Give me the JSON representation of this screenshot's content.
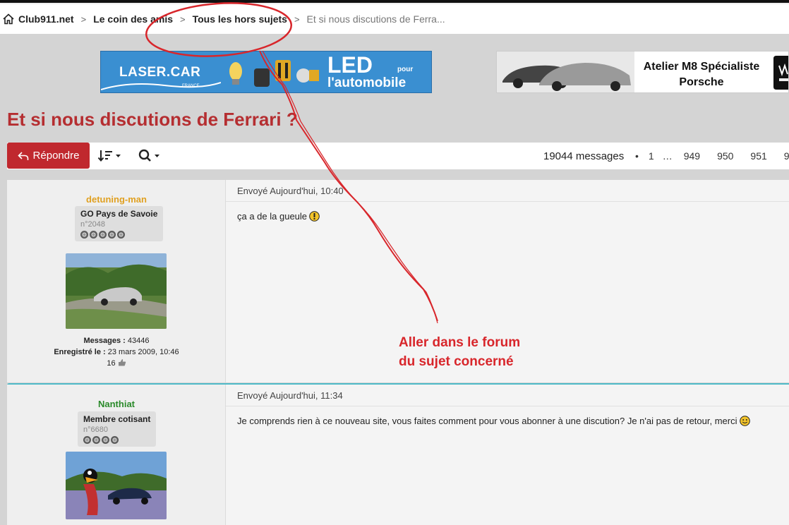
{
  "breadcrumb": {
    "home": "Club911.net",
    "items": [
      "Le coin des amis",
      "Tous les hors sujets"
    ],
    "current": "Et si nous discutions de Ferra...",
    "separator": ">"
  },
  "ads": {
    "laser": {
      "brand": "LASER.CAR",
      "brand_sub": "FRANCE",
      "led": "LED",
      "pour": "pour",
      "automobile": "l'automobile"
    },
    "m8": {
      "line1": "Atelier M8 Spécialiste",
      "line2": "Porsche"
    }
  },
  "thread": {
    "title": "Et si nous discutions de Ferrari ?"
  },
  "toolbar": {
    "reply_label": "Répondre",
    "message_count": "19044 messages",
    "bullet": "•",
    "pages": [
      "1",
      "…",
      "949",
      "950",
      "951",
      "9"
    ]
  },
  "posts": [
    {
      "username": "detuning-man",
      "username_color": "#e0a020",
      "rank": "GO Pays de Savoie",
      "member_number": "n°2048",
      "wheels": 5,
      "messages_label": "Messages :",
      "messages_value": "43446",
      "registered_label": "Enregistré le :",
      "registered_value": "23 mars 2009, 10:46",
      "likes": "16",
      "date": "Envoyé Aujourd'hui, 10:40",
      "body": "ça a de la gueule"
    },
    {
      "username": "Nanthiat",
      "username_color": "#2a8a2a",
      "rank": "Membre cotisant",
      "member_number": "n°6680",
      "wheels": 4,
      "date": "Envoyé Aujourd'hui, 11:34",
      "body": "Je comprends rien à ce nouveau site, vous faites comment pour vous abonner à une discution? Je n'ai pas de retour, merci"
    }
  ],
  "annotation": {
    "line1": "Aller dans le forum",
    "line2": "du sujet concerné",
    "color": "#d8262b"
  }
}
